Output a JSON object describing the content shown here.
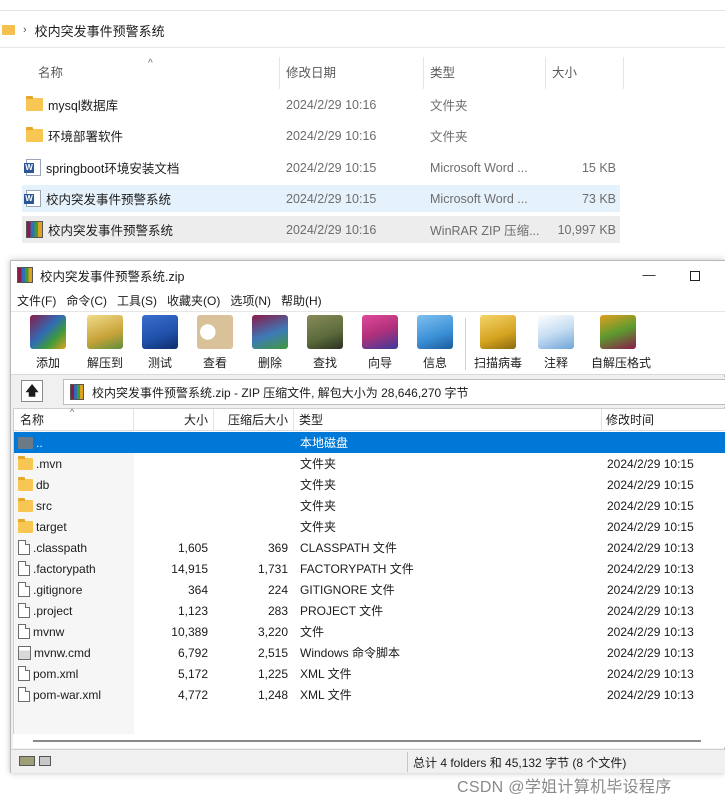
{
  "explorer": {
    "breadcrumb": "校内突发事件预警系统",
    "columns": {
      "name": "名称",
      "date": "修改日期",
      "type": "类型",
      "size": "大小"
    },
    "rows": [
      {
        "name": "mysql数据库",
        "date": "2024/2/29 10:16",
        "type": "文件夹",
        "size": "",
        "icon": "folder-icon"
      },
      {
        "name": "环境部署软件",
        "date": "2024/2/29 10:16",
        "type": "文件夹",
        "size": "",
        "icon": "folder-icon"
      },
      {
        "name": "springboot环境安装文档",
        "date": "2024/2/29 10:15",
        "type": "Microsoft Word ...",
        "size": "15 KB",
        "icon": "word-doc-icon"
      },
      {
        "name": "校内突发事件预警系统",
        "date": "2024/2/29 10:15",
        "type": "Microsoft Word ...",
        "size": "73 KB",
        "icon": "word-doc-icon"
      },
      {
        "name": "校内突发事件预警系统",
        "date": "2024/2/29 10:16",
        "type": "WinRAR ZIP 压缩...",
        "size": "10,997 KB",
        "icon": "winrar-archive-icon"
      }
    ]
  },
  "winrar": {
    "title": "校内突发事件预警系统.zip",
    "window_buttons": {
      "minimize": "—"
    },
    "menu": [
      "文件(F)",
      "命令(C)",
      "工具(S)",
      "收藏夹(O)",
      "选项(N)",
      "帮助(H)"
    ],
    "toolbar": [
      {
        "label": "添加",
        "icon": "add-icon",
        "color": "#8b1a4a"
      },
      {
        "label": "解压到",
        "icon": "extract-to-icon",
        "color": "#c7a23a"
      },
      {
        "label": "测试",
        "icon": "test-icon",
        "color": "#1f4fa8"
      },
      {
        "label": "查看",
        "icon": "view-icon",
        "color": "#d9c29a"
      },
      {
        "label": "删除",
        "icon": "delete-icon",
        "color": "#3d7ab8"
      },
      {
        "label": "查找",
        "icon": "find-icon",
        "color": "#5a6a3a"
      },
      {
        "label": "向导",
        "icon": "wizard-icon",
        "color": "#b0307a"
      },
      {
        "label": "信息",
        "icon": "info-icon",
        "color": "#3a8fd6"
      },
      {
        "label": "扫描病毒",
        "icon": "virus-scan-icon",
        "color": "#d4a320"
      },
      {
        "label": "注释",
        "icon": "comment-icon",
        "color": "#6fa5d8"
      },
      {
        "label": "自解压格式",
        "icon": "sfx-icon",
        "color": "#5c9a2e"
      }
    ],
    "address": "校内突发事件预警系统.zip - ZIP 压缩文件, 解包大小为 28,646,270 字节",
    "up_button": "🡅",
    "columns": {
      "name": "名称",
      "size": "大小",
      "packed": "压缩后大小",
      "type": "类型",
      "modified": "修改时间"
    },
    "rows": [
      {
        "name": "..",
        "size": "",
        "packed": "",
        "type": "本地磁盘",
        "modified": "",
        "icon": "drive-icon",
        "selected": true
      },
      {
        "name": ".mvn",
        "size": "",
        "packed": "",
        "type": "文件夹",
        "modified": "2024/2/29 10:15",
        "icon": "folder-icon"
      },
      {
        "name": "db",
        "size": "",
        "packed": "",
        "type": "文件夹",
        "modified": "2024/2/29 10:15",
        "icon": "folder-icon"
      },
      {
        "name": "src",
        "size": "",
        "packed": "",
        "type": "文件夹",
        "modified": "2024/2/29 10:15",
        "icon": "folder-icon"
      },
      {
        "name": "target",
        "size": "",
        "packed": "",
        "type": "文件夹",
        "modified": "2024/2/29 10:15",
        "icon": "folder-icon"
      },
      {
        "name": ".classpath",
        "size": "1,605",
        "packed": "369",
        "type": "CLASSPATH 文件",
        "modified": "2024/2/29 10:13",
        "icon": "file-icon"
      },
      {
        "name": ".factorypath",
        "size": "14,915",
        "packed": "1,731",
        "type": "FACTORYPATH 文件",
        "modified": "2024/2/29 10:13",
        "icon": "file-icon"
      },
      {
        "name": ".gitignore",
        "size": "364",
        "packed": "224",
        "type": "GITIGNORE 文件",
        "modified": "2024/2/29 10:13",
        "icon": "file-icon"
      },
      {
        "name": ".project",
        "size": "1,123",
        "packed": "283",
        "type": "PROJECT 文件",
        "modified": "2024/2/29 10:13",
        "icon": "file-icon"
      },
      {
        "name": "mvnw",
        "size": "10,389",
        "packed": "3,220",
        "type": "文件",
        "modified": "2024/2/29 10:13",
        "icon": "file-icon"
      },
      {
        "name": "mvnw.cmd",
        "size": "6,792",
        "packed": "2,515",
        "type": "Windows 命令脚本",
        "modified": "2024/2/29 10:13",
        "icon": "cmd-script-icon"
      },
      {
        "name": "pom.xml",
        "size": "5,172",
        "packed": "1,225",
        "type": "XML 文件",
        "modified": "2024/2/29 10:13",
        "icon": "file-icon"
      },
      {
        "name": "pom-war.xml",
        "size": "4,772",
        "packed": "1,248",
        "type": "XML 文件",
        "modified": "2024/2/29 10:13",
        "icon": "file-icon"
      }
    ],
    "status": "总计 4 folders 和 45,132 字节 (8 个文件)"
  },
  "watermark": "CSDN @学姐计算机毕设程序"
}
